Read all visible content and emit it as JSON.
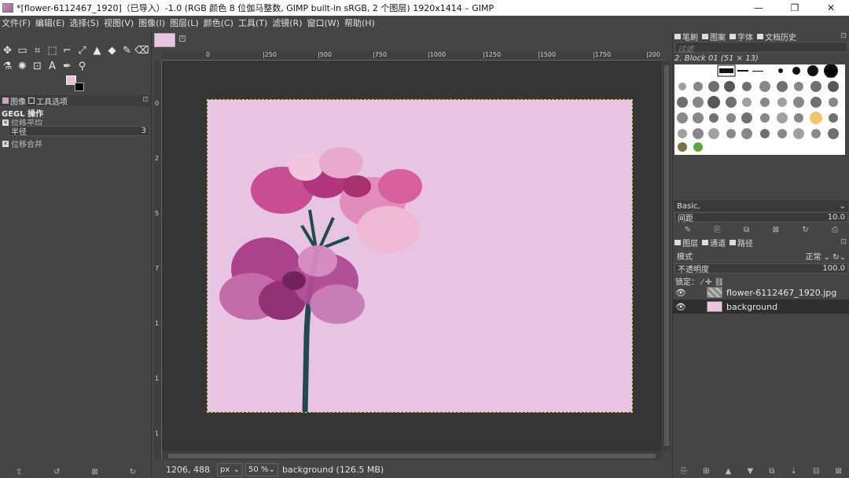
{
  "window": {
    "title": "*[flower-6112467_1920]（已导入）-1.0 (RGB 颜色 8 位伽马整数, GIMP built-in sRGB, 2 个图层) 1920x1414 – GIMP",
    "minimize": "—",
    "maximize": "❐",
    "close": "✕"
  },
  "menu": [
    "文件(F)",
    "编辑(E)",
    "选择(S)",
    "视图(V)",
    "图像(I)",
    "图层(L)",
    "颜色(C)",
    "工具(T)",
    "滤镜(R)",
    "窗口(W)",
    "帮助(H)"
  ],
  "toolbox": {
    "tools_row1": [
      "✥",
      "▭",
      "⌗",
      "⬚",
      "⌐",
      "⤢",
      "▲",
      "◆",
      "✎",
      "⌫"
    ],
    "tools_row2": [
      "⚗",
      "✺",
      "⊡",
      "A",
      "✒",
      "⚲"
    ],
    "tabs": {
      "image": "图像",
      "tool_options": "工具选项"
    },
    "gegl_header": "GEGL 操作",
    "option1": "位移平均",
    "radius_label": "半径",
    "radius_value": "3",
    "option2": "位移合并",
    "bottom_icons": [
      "⇪",
      "↺",
      "⊠",
      "↻"
    ]
  },
  "canvas": {
    "ruler_h": [
      "0",
      "|250",
      "|500",
      "|750",
      "|1000",
      "|1250",
      "|1500",
      "|1750",
      "|200"
    ],
    "ruler_v": [
      "0",
      "2",
      "5",
      "7",
      "1",
      "1",
      "1"
    ],
    "close_x": "×"
  },
  "status": {
    "coords": "1206, 488",
    "unit": "px",
    "zoom": "50 %",
    "message": "background (126.5 MB)"
  },
  "brushes_panel": {
    "tabs": [
      "笔刷",
      "图案",
      "字体",
      "文档历史"
    ],
    "filter_placeholder": "过滤",
    "brush_name": "2. Block 01 (51 × 13)",
    "preset": "Basic,",
    "spacing_label": "间距",
    "spacing_value": "10.0",
    "buttons": [
      "✎",
      "⎘",
      "⧉",
      "⊠",
      "↻",
      "⎙"
    ]
  },
  "layers_panel": {
    "tabs": [
      "图层",
      "通道",
      "路径"
    ],
    "mode_label": "模式",
    "mode_value": "正常",
    "opacity_label": "不透明度",
    "opacity_value": "100.0",
    "lock_label": "锁定：",
    "layers": [
      {
        "name": "flower-6112467_1920.jpg",
        "visible": true
      },
      {
        "name": "background",
        "visible": true
      }
    ],
    "bottom_icons": [
      "⎘",
      "⊞",
      "▲",
      "▼",
      "⧉",
      "⇣",
      "⊟",
      "⊠"
    ]
  },
  "colors": {
    "foreground": "#e6c2dd",
    "background": "#000000",
    "canvas_bg": "#e6c4e2"
  }
}
